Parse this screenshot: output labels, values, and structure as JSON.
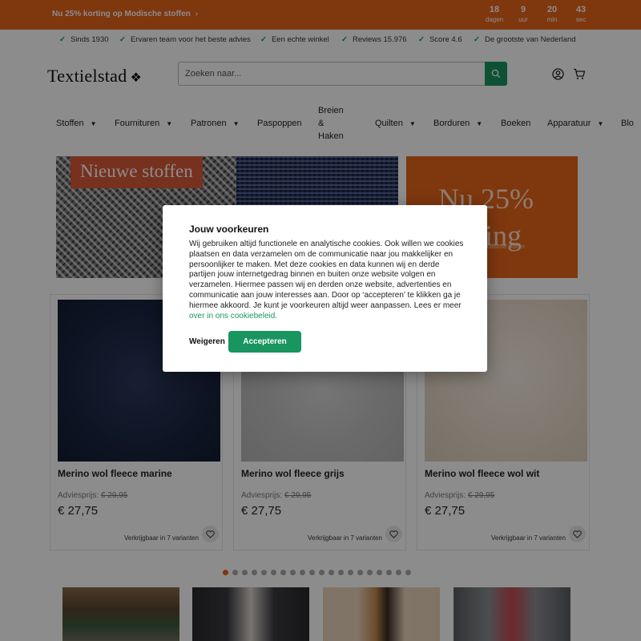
{
  "promo": {
    "text": "Nu 25% korting op Modische stoffen",
    "countdown": [
      {
        "value": "18",
        "unit": "dagen"
      },
      {
        "value": "9",
        "unit": "uur"
      },
      {
        "value": "20",
        "unit": "min"
      },
      {
        "value": "43",
        "unit": "sec"
      }
    ]
  },
  "usps": [
    "Sinds 1930",
    "Ervaren team voor het beste advies",
    "Een echte winkel",
    "Reviews 15.976",
    "Score 4.6",
    "De grootste van Nederland"
  ],
  "header": {
    "logo": "Textielstad",
    "logo_mark": "❖",
    "search_placeholder": "Zoeken naar..."
  },
  "nav": {
    "items": [
      {
        "label": "Stoffen",
        "dropdown": true
      },
      {
        "label": "Fournituren",
        "dropdown": true
      },
      {
        "label": "Patronen",
        "dropdown": true
      },
      {
        "label": "Paspoppen",
        "dropdown": false
      },
      {
        "label": "Quilten",
        "dropdown": true
      },
      {
        "label": "Borduren",
        "dropdown": true
      },
      {
        "label": "Boeken",
        "dropdown": false
      },
      {
        "label": "Apparatuur",
        "dropdown": true
      },
      {
        "label": "Blo",
        "dropdown": false
      }
    ],
    "stacked": [
      "Breien",
      "&",
      "Haken"
    ]
  },
  "banners": {
    "left_tag": "Nieuwe stoffen",
    "right_big_1": "Nu 25%",
    "right_big_2": "korting",
    "right_small": "modische stoffen"
  },
  "products": [
    {
      "name": "Merino wol fleece marine",
      "advice_label": "Adviesprijs:",
      "advice_price": "€ 29,95",
      "price": "€ 27,75",
      "variants": "Verkrijgbaar in 7 varianten"
    },
    {
      "name": "Merino wol fleece grijs",
      "advice_label": "Adviesprijs:",
      "advice_price": "€ 29,95",
      "price": "€ 27,75",
      "variants": "Verkrijgbaar in 7 varianten"
    },
    {
      "name": "Merino wol fleece wol wit",
      "advice_label": "Adviesprijs:",
      "advice_price": "€ 29,95",
      "price": "€ 27,75",
      "variants": "Verkrijgbaar in 7 varianten"
    }
  ],
  "carousel": {
    "total_dots": 20,
    "active_index": 0
  },
  "cookie": {
    "title": "Jouw voorkeuren",
    "body": "Wij gebruiken altijd functionele en analytische cookies. Ook willen we cookies plaatsen en data verzamelen om de communicatie naar jou makkelijker en persoonlijker te maken. Met deze cookies en data kunnen wij en derde partijen jouw internetgedrag binnen en buiten onze website volgen en verzamelen. Hiermee passen wij en derden onze website, advertenties en communicatie aan jouw interesses aan. Door op ‘accepteren’ te klikken ga je hiermee akkoord. Je kunt je voorkeuren altijd weer aanpassen. Lees er meer",
    "link": "over in ons cookiebeleid.",
    "refuse": "Weigeren",
    "accept": "Accepteren"
  },
  "colors": {
    "brand_orange": "#e8641b",
    "accent_green": "#19955f"
  }
}
